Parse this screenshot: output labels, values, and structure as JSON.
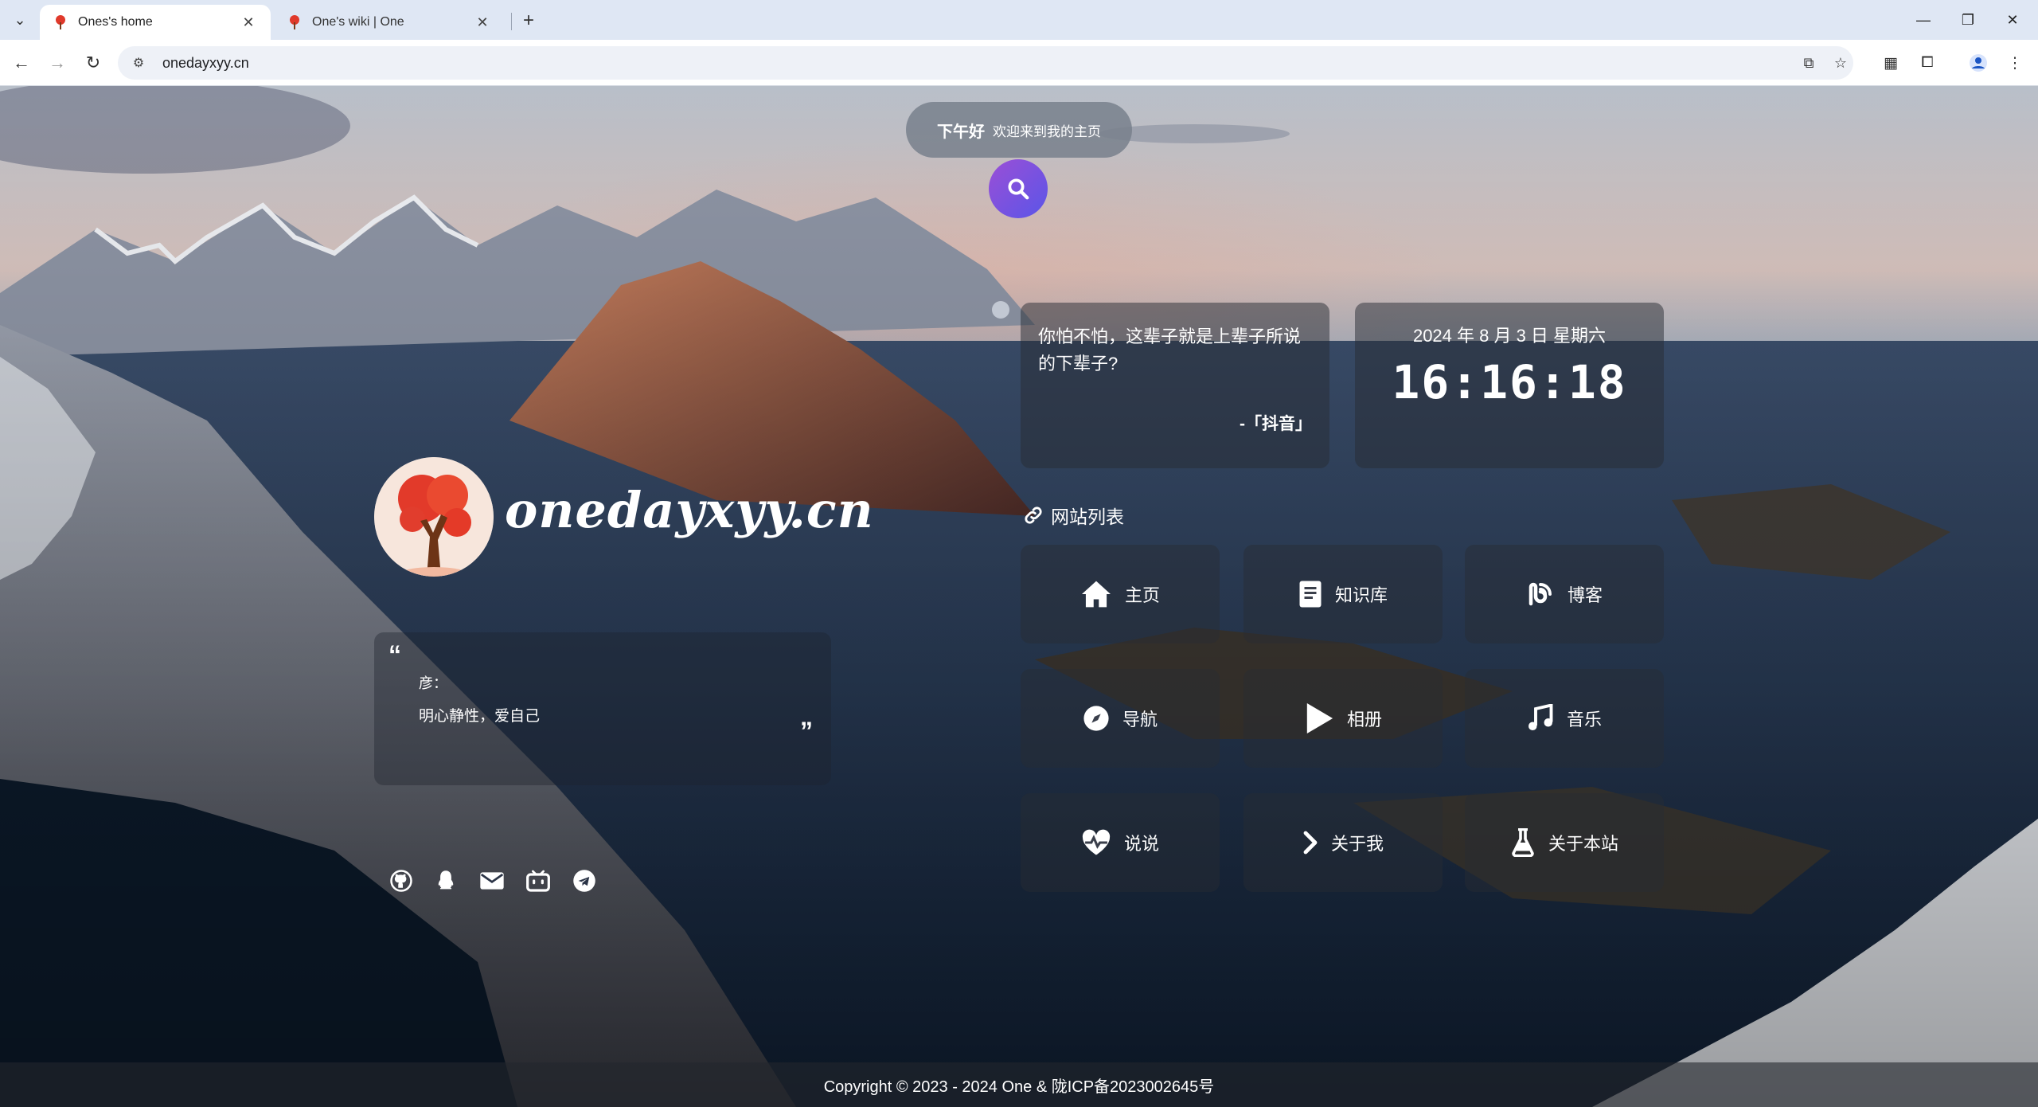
{
  "browser": {
    "tabs": [
      {
        "title": "Ones's home",
        "active": true
      },
      {
        "title": "One's wiki | One",
        "active": false
      }
    ],
    "url": "onedayxyy.cn"
  },
  "greeting": {
    "main": "下午好",
    "sub": "欢迎来到我的主页"
  },
  "logo": {
    "text": "onedayxyy.cn"
  },
  "motto": {
    "open_quote": "“",
    "label": "彦：",
    "text": "明心静性，爱自己",
    "close_quote": "”"
  },
  "hitokoto": {
    "text": "你怕不怕，这辈子就是上辈子所说的下辈子?",
    "from": "-「抖音」"
  },
  "clock": {
    "date": "2024 年 8 月 3 日 星期六",
    "time": "16:16:18"
  },
  "sites": {
    "title": "网站列表",
    "items": [
      {
        "label": "主页",
        "icon": "home-icon"
      },
      {
        "label": "知识库",
        "icon": "book-icon"
      },
      {
        "label": "博客",
        "icon": "blog-icon"
      },
      {
        "label": "导航",
        "icon": "compass-icon"
      },
      {
        "label": "相册",
        "icon": "play-icon"
      },
      {
        "label": "音乐",
        "icon": "music-icon"
      },
      {
        "label": "说说",
        "icon": "heartbeat-icon"
      },
      {
        "label": "关于我",
        "icon": "chevron-right-icon"
      },
      {
        "label": "关于本站",
        "icon": "flask-icon"
      }
    ]
  },
  "social": [
    "github-icon",
    "qq-icon",
    "mail-icon",
    "bilibili-icon",
    "telegram-icon"
  ],
  "footer": {
    "text": "Copyright © 2023 - 2024 One & 陇ICP备2023002645号"
  },
  "colors": {
    "accent": "#7a52e0",
    "card_bg": "rgba(40,44,52,0.45)"
  }
}
